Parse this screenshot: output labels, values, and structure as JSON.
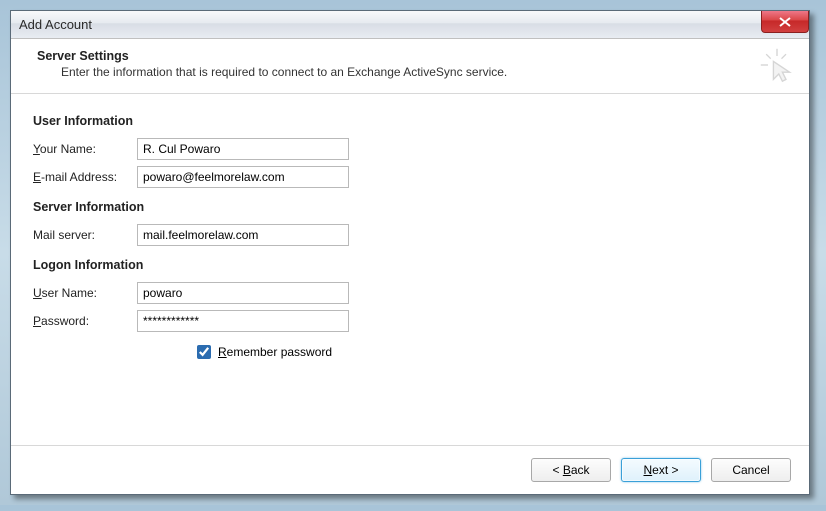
{
  "window": {
    "title": "Add Account"
  },
  "header": {
    "title": "Server Settings",
    "subtitle": "Enter the information that is required to connect to an Exchange ActiveSync service."
  },
  "sections": {
    "user": {
      "heading": "User Information",
      "your_name_label_pre": "Y",
      "your_name_label_rest": "our Name:",
      "your_name_value": "R. Cul Powaro",
      "email_label_pre": "E",
      "email_label_rest": "-mail Address:",
      "email_value": "powaro@feelmorelaw.com"
    },
    "server": {
      "heading": "Server Information",
      "mail_server_label": "Mail server:",
      "mail_server_value": "mail.feelmorelaw.com"
    },
    "logon": {
      "heading": "Logon Information",
      "user_name_label_pre": "U",
      "user_name_label_rest": "ser Name:",
      "user_name_value": "powaro",
      "password_label_pre": "P",
      "password_label_rest": "assword:",
      "password_value": "************",
      "remember_pre": "R",
      "remember_rest": "emember password",
      "remember_checked": true
    }
  },
  "buttons": {
    "back_pre": "< ",
    "back_ul": "B",
    "back_rest": "ack",
    "next_ul": "N",
    "next_rest": "ext >",
    "cancel": "Cancel"
  }
}
